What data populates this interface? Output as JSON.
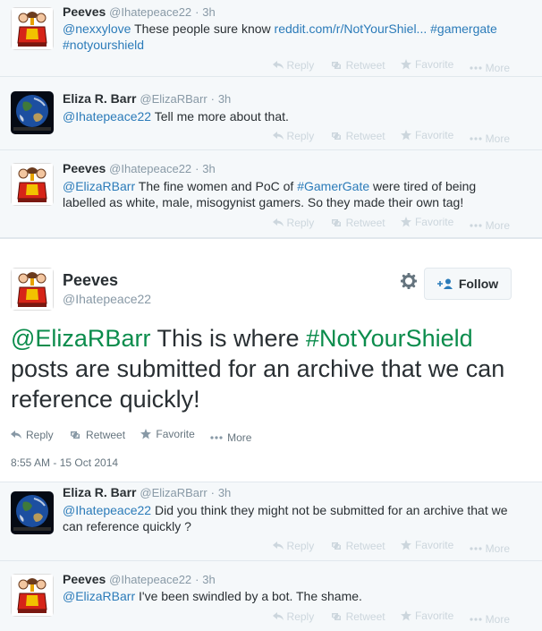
{
  "colors": {
    "hashtag": "#0b8c4c",
    "link": "#2b7bb9",
    "muted": "#8899a6",
    "light": "#ccd6dd"
  },
  "action_labels": {
    "reply": "Reply",
    "retweet": "Retweet",
    "favorite": "Favorite",
    "more": "More"
  },
  "tweets": [
    {
      "name": "Peeves",
      "handle": "@Ihatepeace22",
      "time": "3h",
      "avatar": "peeves-avatar",
      "text": {
        "mention": "@nexxylove",
        "t1": " These people sure know ",
        "link": "reddit.com/r/NotYourShiel...",
        "sp": " ",
        "hash1": "#gamergate",
        "hash2": "#notyourshield"
      }
    },
    {
      "name": "Eliza R. Barr",
      "handle": "@ElizaRBarr",
      "time": "3h",
      "avatar": "earth-avatar",
      "text": {
        "mention": "@Ihatepeace22",
        "t1": " Tell me more about that."
      }
    },
    {
      "name": "Peeves",
      "handle": "@Ihatepeace22",
      "time": "3h",
      "avatar": "peeves-avatar",
      "text": {
        "mention": "@ElizaRBarr",
        "t1": " The fine women and PoC of ",
        "hash1": "#GamerGate",
        "t2": " were tired of being labelled as white, male, misogynist gamers. So they made their own tag!"
      }
    }
  ],
  "focus_tweet": {
    "name": "Peeves",
    "handle": "@Ihatepeace22",
    "follow_label": "Follow",
    "text": {
      "mention": "@ElizaRBarr",
      "t1": " This is where ",
      "hash1": "#NotYourShield",
      "t2": " posts are submitted for an archive that we can reference quickly!"
    },
    "timestamp": "8:55 AM - 15 Oct 2014"
  },
  "replies": [
    {
      "name": "Eliza R. Barr",
      "handle": "@ElizaRBarr",
      "time": "3h",
      "avatar": "earth-avatar",
      "text": {
        "mention": "@Ihatepeace22",
        "t1": " Did you think they might not be submitted for an archive that we can reference quickly ?"
      }
    },
    {
      "name": "Peeves",
      "handle": "@Ihatepeace22",
      "time": "3h",
      "avatar": "peeves-avatar",
      "text": {
        "mention": "@ElizaRBarr",
        "t1": " I've been swindled by a bot. The shame."
      }
    }
  ]
}
